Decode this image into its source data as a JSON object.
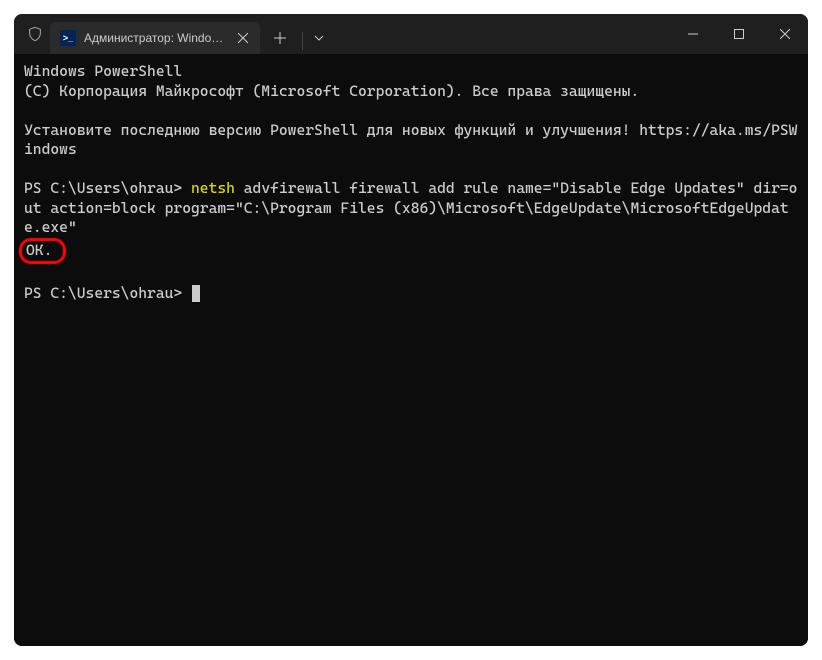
{
  "tab": {
    "title": "Администратор: Windows Po",
    "icon_label": ">_"
  },
  "terminal": {
    "header1": "Windows PowerShell",
    "header2": "(C) Корпорация Майкрософт (Microsoft Corporation). Все права защищены.",
    "notice": "Установите последнюю версию PowerShell для новых функций и улучшения! https://aka.ms/PSWindows",
    "prompt1": "PS C:\\Users\\ohrau> ",
    "cmd_name": "netsh",
    "cmd_args": " advfirewall firewall add rule name=\"Disable Edge Updates\" dir=out action=block program=\"C:\\Program Files (x86)\\Microsoft\\EdgeUpdate\\MicrosoftEdgeUpdate.exe\"",
    "result": "ОК.",
    "prompt2": "PS C:\\Users\\ohrau> "
  }
}
